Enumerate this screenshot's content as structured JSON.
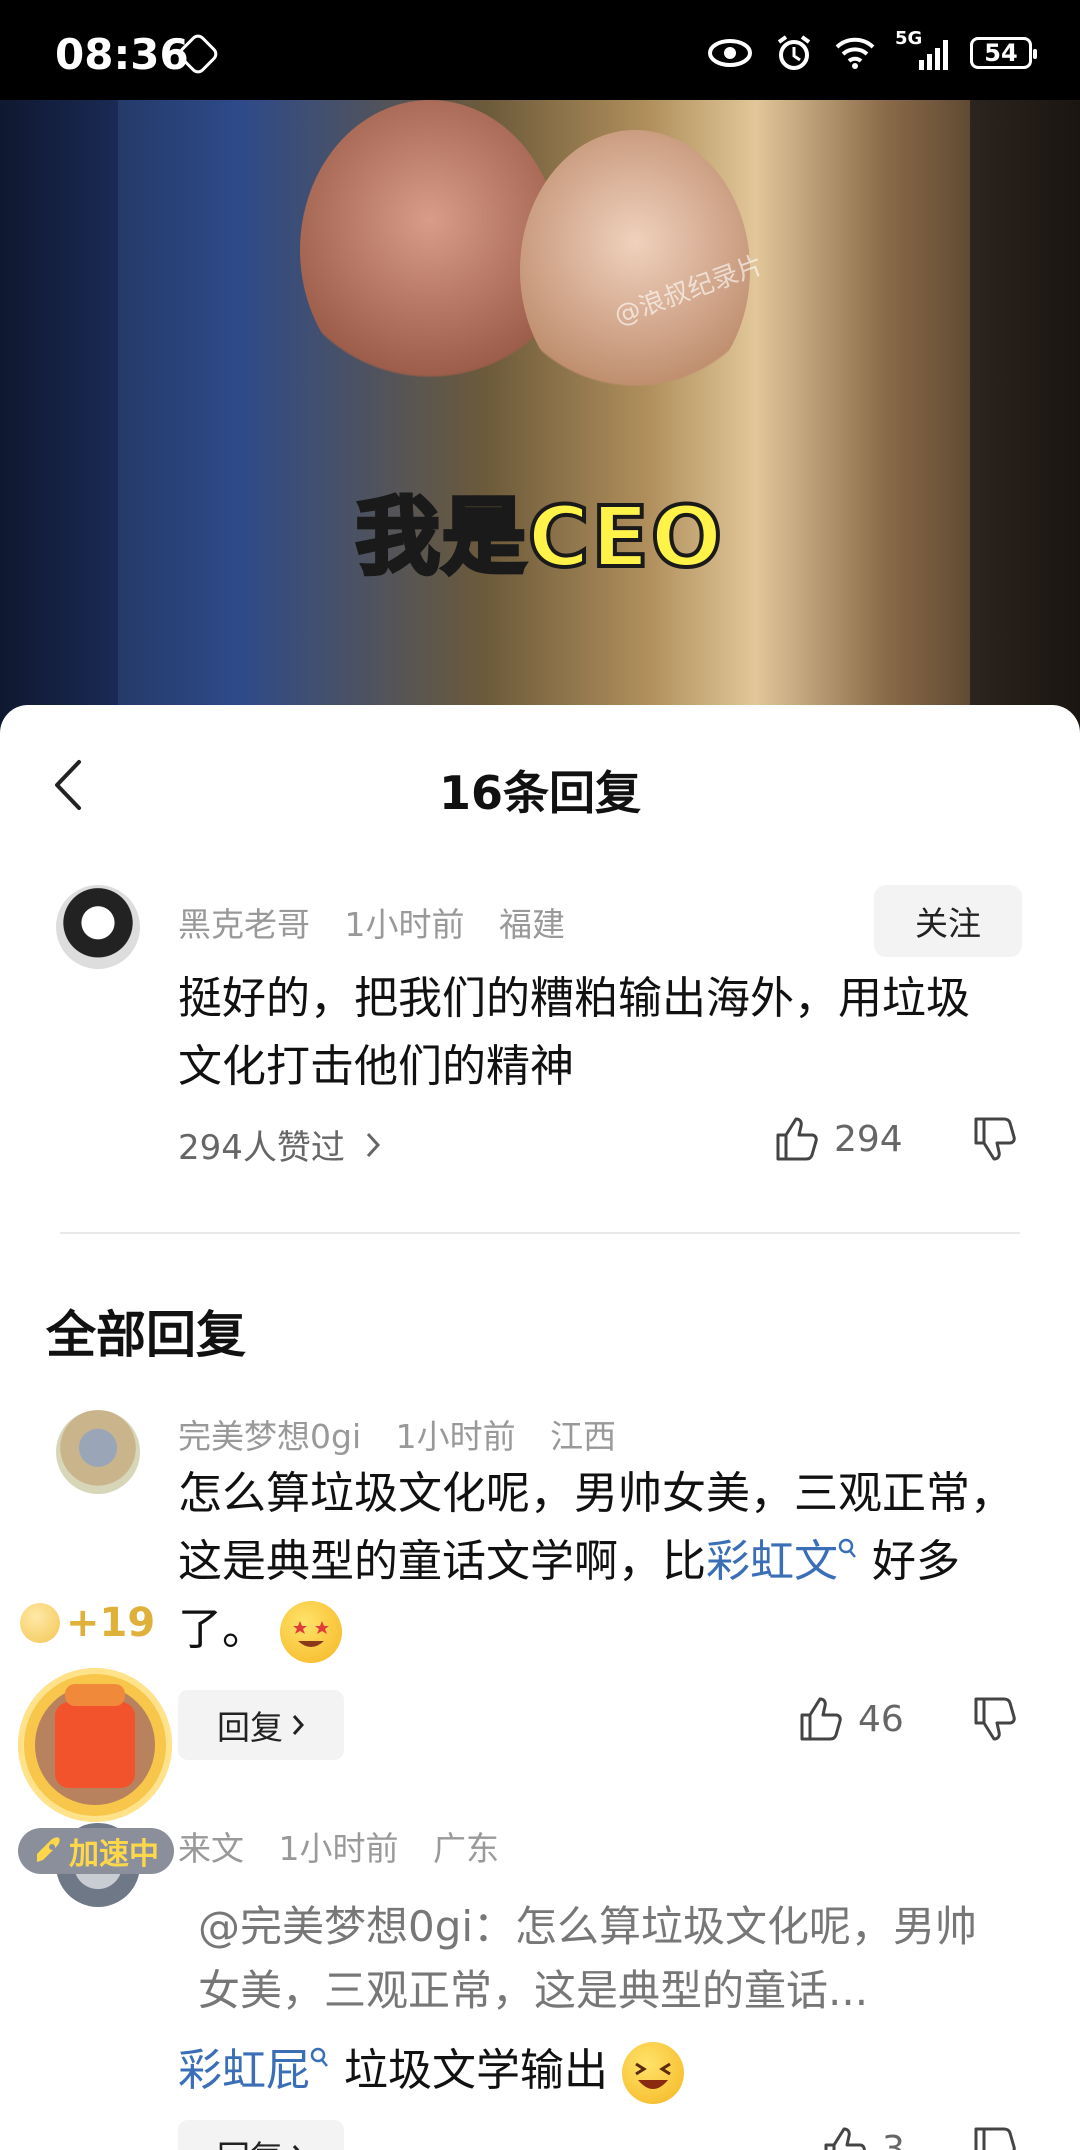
{
  "status_bar": {
    "time": "08:36",
    "network": "5G",
    "battery": "54",
    "icons": [
      "gesture-icon",
      "eye-icon",
      "alarm-icon",
      "wifi-icon",
      "signal-icon",
      "battery-icon"
    ]
  },
  "video": {
    "caption": "我是CEO",
    "watermark": "@浪叔纪录片"
  },
  "sheet": {
    "title": "16条回复"
  },
  "main_comment": {
    "username": "黑克老哥",
    "time": "1小时前",
    "location": "福建",
    "follow_label": "关注",
    "text": "挺好的，把我们的糟粕输出海外，用垃圾文化打击他们的精神",
    "likers_label": "294人赞过",
    "like_count": "294"
  },
  "section_title": "全部回复",
  "replies": [
    {
      "username": "完美梦想0gi",
      "time": "1小时前",
      "location": "江西",
      "text_a": "怎么算垃圾文化呢，男帅女美，三观正常，这是典型的童话文学啊，比",
      "link": "彩虹文",
      "text_b": " 好多了。",
      "reply_label": "回复",
      "like_count": "46"
    },
    {
      "username": "来文",
      "time": "1小时前",
      "location": "广东",
      "quote": "@完美梦想0gi：怎么算垃圾文化呢，男帅女美，三观正常，这是典型的童话...",
      "link": "彩虹屁",
      "text": " 垃圾文学输出",
      "reply_label": "回复",
      "like_count": "3"
    }
  ],
  "reward": {
    "plus": "+19",
    "status": "加速中"
  }
}
